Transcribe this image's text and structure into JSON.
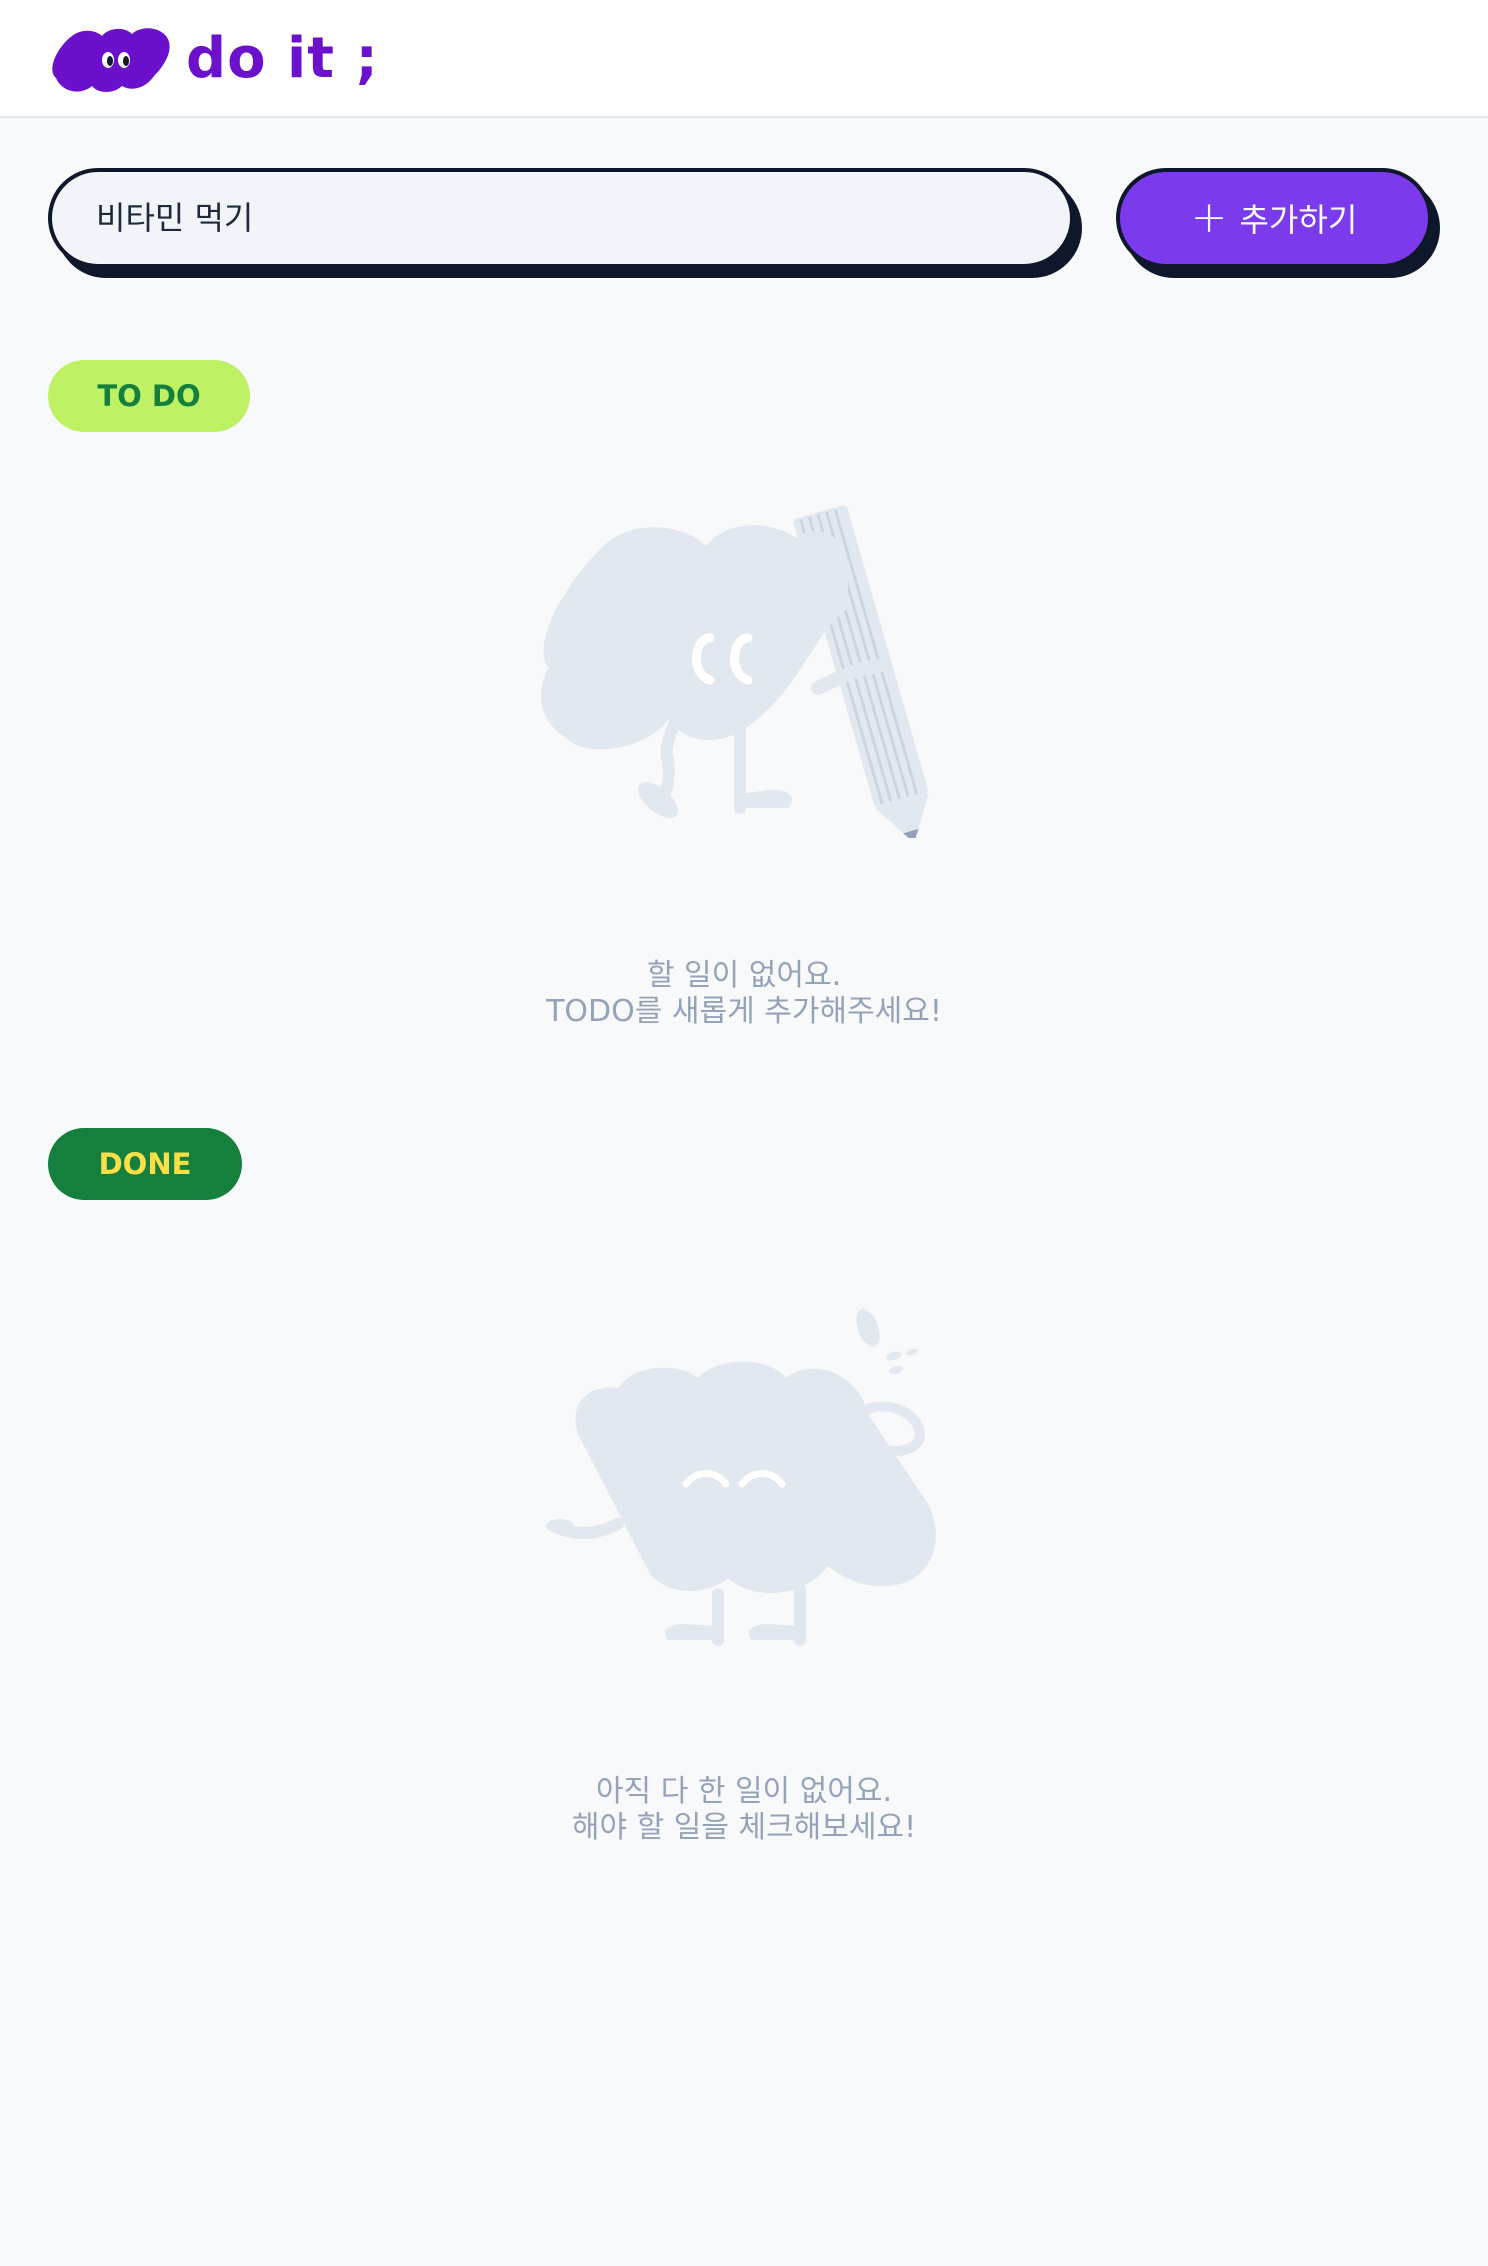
{
  "header": {
    "logo_text": "do it ;",
    "logo_icon": "cloud-mascot-icon"
  },
  "search": {
    "placeholder": "비타민 먹기",
    "value": ""
  },
  "add_button": {
    "icon": "plus-icon",
    "icon_glyph": "+",
    "label": "추가하기"
  },
  "todo_section": {
    "badge": "TO DO",
    "illustration": "cloud-with-pencil-icon",
    "empty_line1": "할 일이 없어요.",
    "empty_line2": "TODO를 새롭게 추가해주세요!"
  },
  "done_section": {
    "badge": "DONE",
    "illustration": "cloud-smiling-icon",
    "empty_line1": "아직 다 한 일이 없어요.",
    "empty_line2": "해야 할 일을 체크해보세요!"
  },
  "colors": {
    "brand": "#6b11cc",
    "accent": "#7c3aed",
    "todo_badge_bg": "#bef264",
    "todo_badge_text": "#15803d",
    "done_badge_bg": "#15803d",
    "done_badge_text": "#fde047",
    "empty_text": "#94a3b8",
    "illustration": "#e2e8f0"
  }
}
